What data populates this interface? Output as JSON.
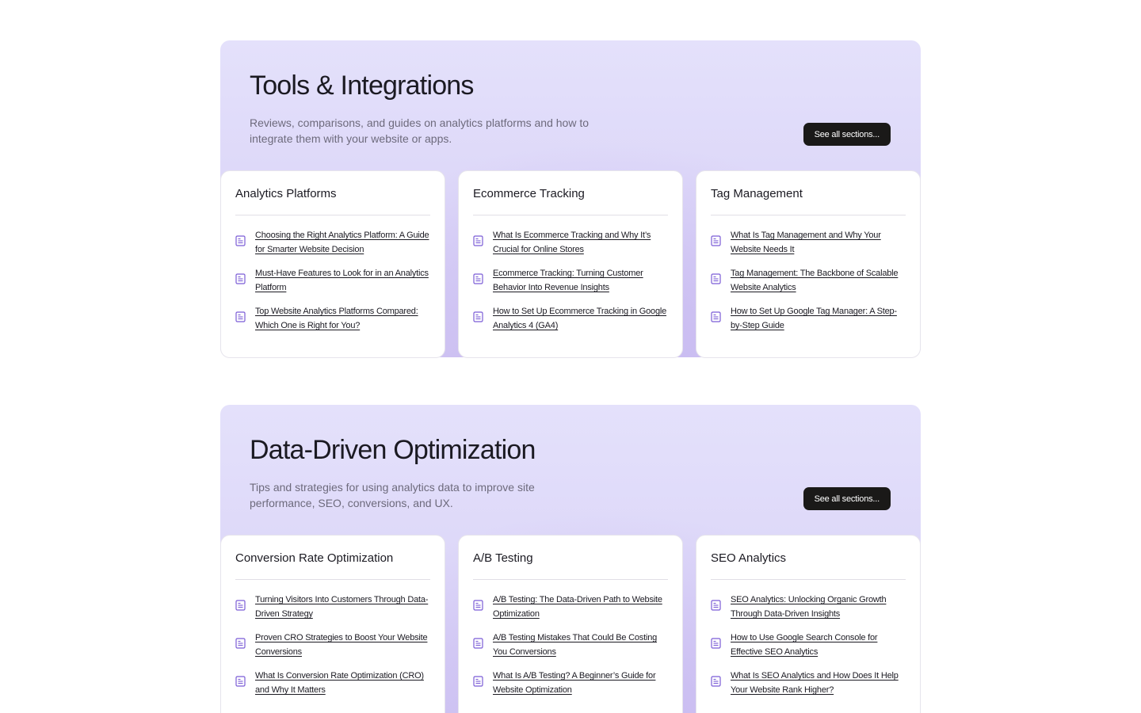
{
  "sections": [
    {
      "title": "Tools & Integrations",
      "description": "Reviews, comparisons, and guides on analytics platforms and how to integrate them with your website or apps.",
      "see_all_label": "See all sections...",
      "cards": [
        {
          "title": "Analytics Platforms",
          "articles": [
            "Choosing the Right Analytics Platform: A Guide for Smarter Website Decision",
            "Must-Have Features to Look for in an Analytics Platform",
            "Top Website Analytics Platforms Compared: Which One is Right for You?"
          ]
        },
        {
          "title": "Ecommerce Tracking",
          "articles": [
            "What Is Ecommerce Tracking and Why It’s Crucial for Online Stores",
            "Ecommerce Tracking: Turning Customer Behavior Into Revenue Insights",
            "How to Set Up Ecommerce Tracking in Google Analytics 4 (GA4)"
          ]
        },
        {
          "title": "Tag Management",
          "articles": [
            "What Is Tag Management and Why Your Website Needs It",
            "Tag Management: The Backbone of Scalable Website Analytics",
            "How to Set Up Google Tag Manager: A Step-by-Step Guide"
          ]
        }
      ]
    },
    {
      "title": "Data-Driven Optimization",
      "description": "Tips and strategies for using analytics data to improve site performance, SEO, conversions, and UX.",
      "see_all_label": "See all sections...",
      "cards": [
        {
          "title": "Conversion Rate Optimization",
          "articles": [
            "Turning Visitors Into Customers Through Data-Driven Strategy",
            "Proven CRO Strategies to Boost Your Website Conversions",
            "What Is Conversion Rate Optimization (CRO) and Why It Matters"
          ]
        },
        {
          "title": "A/B Testing",
          "articles": [
            "A/B Testing: The Data-Driven Path to Website Optimization",
            "A/B Testing Mistakes That Could Be Costing You Conversions",
            "What Is A/B Testing? A Beginner’s Guide for Website Optimization"
          ]
        },
        {
          "title": "SEO Analytics",
          "articles": [
            "SEO Analytics: Unlocking Organic Growth Through Data-Driven Insights",
            "How to Use Google Search Console for Effective SEO Analytics",
            "What Is SEO Analytics and How Does It Help Your Website Rank Higher?"
          ]
        }
      ]
    }
  ],
  "icons": {
    "article": "document-icon"
  },
  "colors": {
    "accent": "#7b5cd6",
    "button_bg": "#1a1918",
    "section_bg": "#dcd6f8"
  }
}
